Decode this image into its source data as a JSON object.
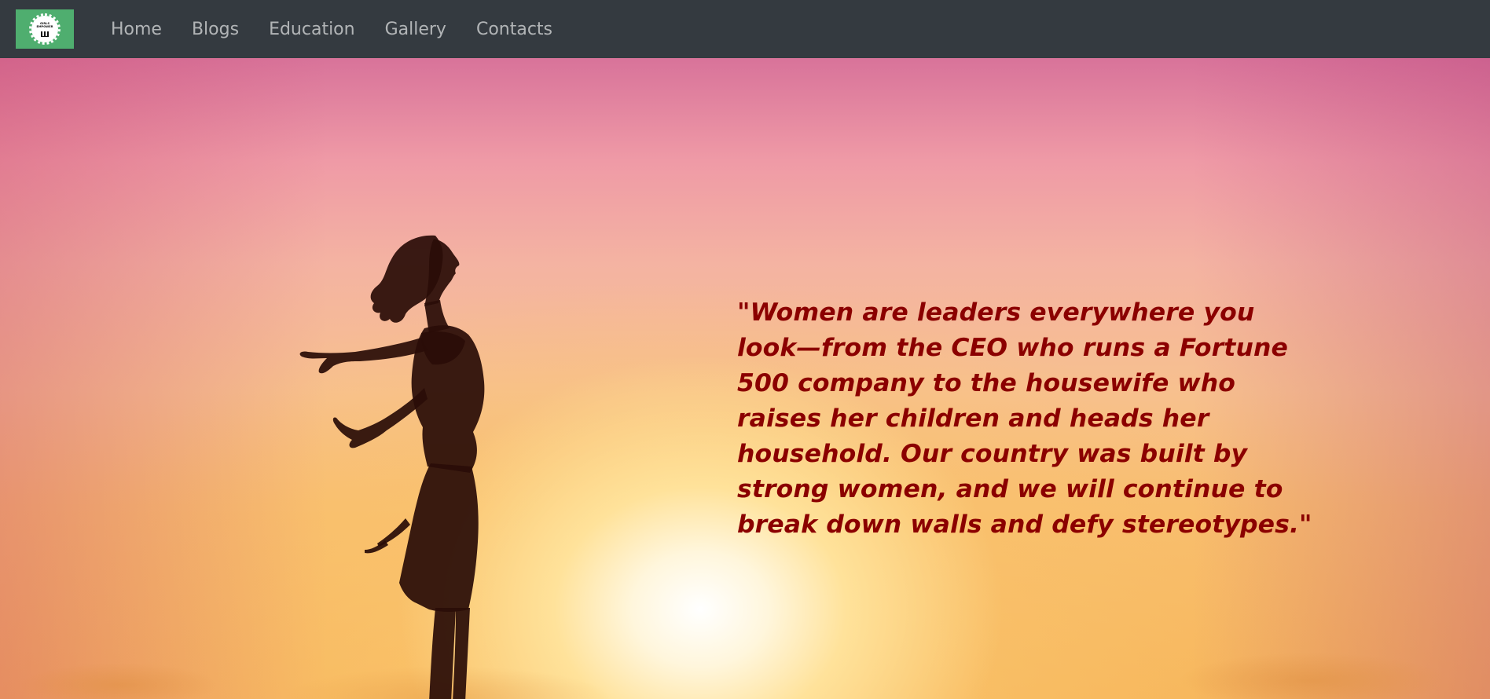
{
  "navbar": {
    "brand": {
      "logo_text": "GIRLS EMPOWERMENT",
      "icon": "logo-badge-icon"
    },
    "links": [
      {
        "label": "Home"
      },
      {
        "label": "Blogs"
      },
      {
        "label": "Education"
      },
      {
        "label": "Gallery"
      },
      {
        "label": "Contacts"
      }
    ],
    "background_color": "#343a40",
    "brand_color": "#4fae6f"
  },
  "hero": {
    "quote": "\"Women are leaders everywhere you look—from the CEO who runs a Fortune 500 company to the housewife who raises her children and heads her household. Our country was built by strong women, and we will continue to break down walls and defy stereotypes.\"",
    "quote_color": "#8b0000",
    "image": "woman-silhouette-sunset"
  }
}
